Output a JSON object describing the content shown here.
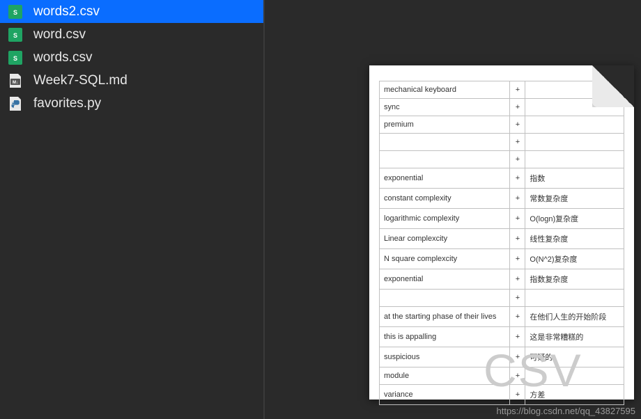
{
  "files": [
    {
      "name": "words2.csv",
      "icon": "csv",
      "selected": true
    },
    {
      "name": "word.csv",
      "icon": "csv",
      "selected": false
    },
    {
      "name": "words.csv",
      "icon": "csv",
      "selected": false
    },
    {
      "name": "Week7-SQL.md",
      "icon": "md",
      "selected": false
    },
    {
      "name": "favorites.py",
      "icon": "py",
      "selected": false
    }
  ],
  "preview": {
    "watermark": "CSV",
    "rows": [
      {
        "c1": "mechanical keyboard",
        "c2": "+",
        "c3": ""
      },
      {
        "c1": "sync",
        "c2": "+",
        "c3": ""
      },
      {
        "c1": "premium",
        "c2": "+",
        "c3": ""
      },
      {
        "c1": "",
        "c2": "+",
        "c3": ""
      },
      {
        "c1": "",
        "c2": "+",
        "c3": ""
      },
      {
        "c1": "exponential",
        "c2": "+",
        "c3": "指数"
      },
      {
        "c1": "constant complexity",
        "c2": "+",
        "c3": "常数复杂度"
      },
      {
        "c1": "logarithmic complexity",
        "c2": "+",
        "c3": "O(logn)复杂度"
      },
      {
        "c1": "Linear complexcity",
        "c2": "+",
        "c3": "线性复杂度"
      },
      {
        "c1": "N square complexcity",
        "c2": "+",
        "c3": "O(N^2)复杂度"
      },
      {
        "c1": "exponential",
        "c2": "+",
        "c3": "指数复杂度"
      },
      {
        "c1": "",
        "c2": "+",
        "c3": ""
      },
      {
        "c1": "at the starting phase of their lives",
        "c2": "+",
        "c3": "在他们人生的开始阶段"
      },
      {
        "c1": "this is appalling",
        "c2": "+",
        "c3": "这是非常糟糕的"
      },
      {
        "c1": "suspicious",
        "c2": "+",
        "c3": "可疑的"
      },
      {
        "c1": "module",
        "c2": "+",
        "c3": ""
      },
      {
        "c1": "variance",
        "c2": "+",
        "c3": "方差"
      }
    ]
  },
  "footer_url": "https://blog.csdn.net/qq_43827595"
}
